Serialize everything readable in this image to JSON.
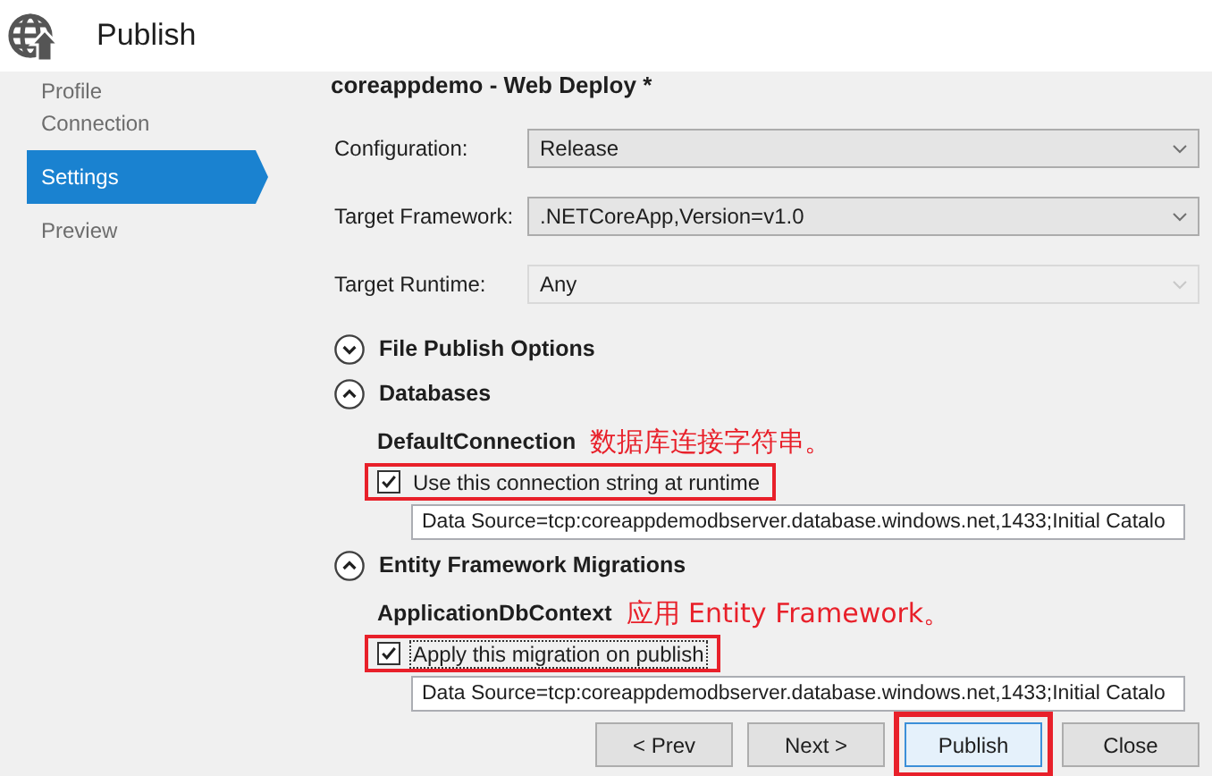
{
  "window": {
    "title": "Publish"
  },
  "sidebar": {
    "items": [
      {
        "label": "Profile",
        "selected": false
      },
      {
        "label": "Connection",
        "selected": false
      },
      {
        "label": "Settings",
        "selected": true
      },
      {
        "label": "Preview",
        "selected": false
      }
    ]
  },
  "heading": "coreappdemo - Web Deploy *",
  "fields": [
    {
      "label": "Configuration:",
      "value": "Release",
      "disabled": false
    },
    {
      "label": "Target Framework:",
      "value": ".NETCoreApp,Version=v1.0",
      "disabled": false
    },
    {
      "label": "Target Runtime:",
      "value": "Any",
      "disabled": true
    }
  ],
  "sections": [
    {
      "title": "File Publish Options",
      "expanded": false
    },
    {
      "title": "Databases",
      "expanded": true,
      "name": "DefaultConnection",
      "note": "数据库连接字符串。",
      "option": {
        "label": "Use this connection string at runtime",
        "checked": true,
        "focused": false,
        "highlighted": true
      },
      "value": "Data Source=tcp:coreappdemodbserver.database.windows.net,1433;Initial Catalo"
    },
    {
      "title": "Entity Framework Migrations",
      "expanded": true,
      "name": "ApplicationDbContext",
      "note": "应用 Entity Framework。",
      "option": {
        "label": "Apply this migration on publish",
        "checked": true,
        "focused": true,
        "highlighted": true
      },
      "value": "Data Source=tcp:coreappdemodbserver.database.windows.net,1433;Initial Catalo"
    }
  ],
  "buttons": [
    {
      "label": "< Prev",
      "focused": false,
      "highlighted": false
    },
    {
      "label": "Next >",
      "focused": false,
      "highlighted": false
    },
    {
      "label": "Publish",
      "focused": true,
      "highlighted": true
    },
    {
      "label": "Close",
      "focused": false,
      "highlighted": false
    }
  ]
}
